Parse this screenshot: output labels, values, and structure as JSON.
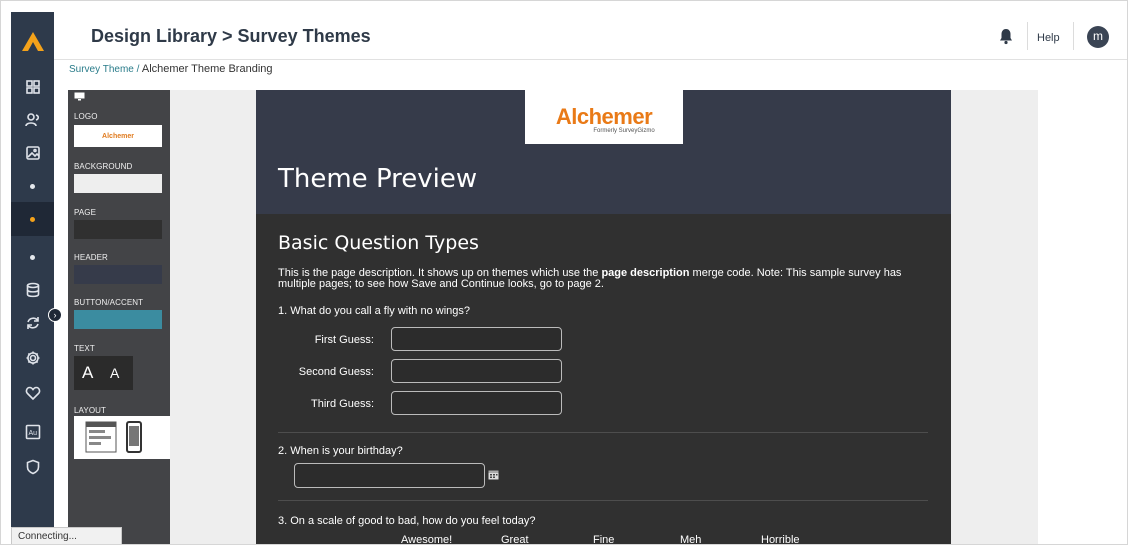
{
  "header": {
    "title": "Design Library > Survey Themes",
    "help_label": "Help",
    "avatar_initial": "m"
  },
  "breadcrumb": {
    "parent": "Survey Theme /",
    "current": "Alchemer Theme Branding"
  },
  "nav": {
    "icons": [
      "alchemer-logo-icon",
      "dashboard-grid-icon",
      "users-icon",
      "image-icon",
      "dot-icon",
      "dot-icon",
      "dot-icon",
      "database-icon",
      "sync-icon",
      "settings-gear-icon",
      "heart-icon",
      "au-icon",
      "shield-icon"
    ],
    "accent_color": "#f4a21a"
  },
  "theme_panel": {
    "logo_label": "LOGO",
    "logo_text": "Alchemer",
    "background_label": "BACKGROUND",
    "page_label": "PAGE",
    "header_label": "HEADER",
    "button_accent_label": "BUTTON/ACCENT",
    "text_label": "TEXT",
    "text_sample_1": "A",
    "text_sample_2": "A",
    "layout_label": "LAYOUT",
    "colors": {
      "background": "#eeeeee",
      "page": "#303030",
      "header": "#363b4a",
      "button_accent": "#3b8ca0"
    }
  },
  "preview": {
    "logo_brand": "Alchemer",
    "logo_sub": "Formerly SurveyGizmo",
    "theme_title": "Theme Preview",
    "page_heading": "Basic Question Types",
    "desc_part1": "This is the page description. It shows up on themes which use the ",
    "desc_bold": "page description",
    "desc_part2": " merge code. Note: This sample survey has multiple pages; to see how Save and Continue looks, go to page 2.",
    "q1": "1. What do you call a fly with no wings?",
    "guess_labels": [
      "First Guess:",
      "Second Guess:",
      "Third Guess:"
    ],
    "q2": "2. When is your birthday?",
    "q3": "3. On a scale of good to bad, how do you feel today?",
    "scale": [
      "Awesome!",
      "Great",
      "Fine",
      "Meh",
      "Horrible"
    ]
  },
  "status": {
    "text": "Connecting..."
  }
}
